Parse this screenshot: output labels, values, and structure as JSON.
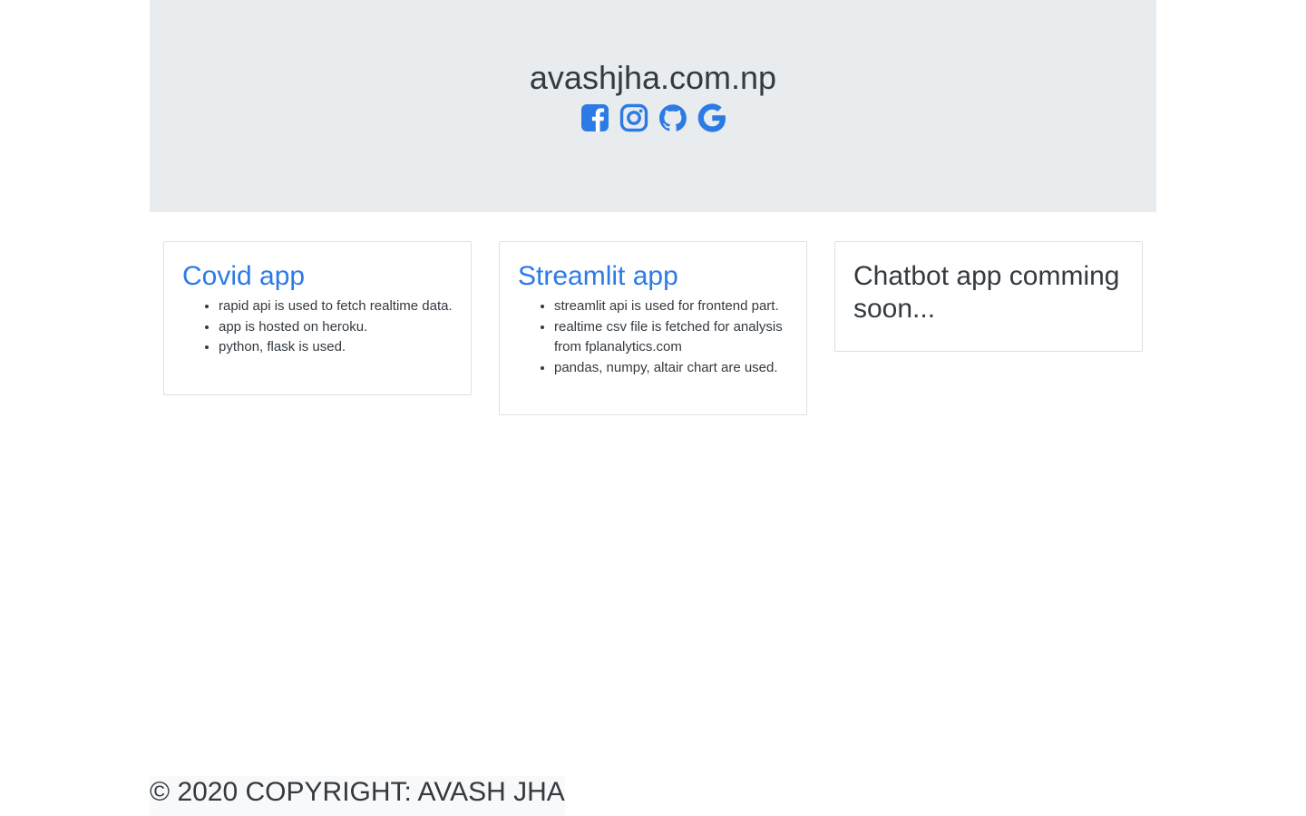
{
  "header": {
    "site_title": "avashjha.com.np",
    "social_icons": [
      {
        "name": "facebook-square-icon"
      },
      {
        "name": "instagram-icon"
      },
      {
        "name": "github-icon"
      },
      {
        "name": "google-icon"
      }
    ],
    "accent_color": "#2c7be5",
    "background_color": "#e9ecef"
  },
  "cards": [
    {
      "title": "Covid app",
      "items": [
        "rapid api is used to fetch realtime data.",
        "app is hosted on heroku.",
        "python, flask is used."
      ]
    },
    {
      "title": "Streamlit app",
      "items": [
        "streamlit api is used for frontend part.",
        "realtime csv file is fetched for analysis from fplanalytics.com",
        "pandas, numpy, altair chart are used."
      ]
    },
    {
      "title": "Chatbot app comming soon...",
      "items": []
    }
  ],
  "footer": {
    "copyright": "© 2020 Copyright: Avash Jha"
  }
}
